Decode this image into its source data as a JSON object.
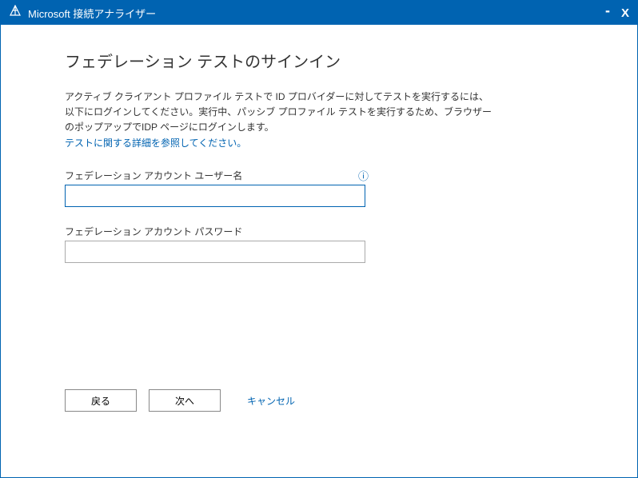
{
  "titlebar": {
    "app_title": "Microsoft 接続アナライザー",
    "minimize": "-",
    "close": "X"
  },
  "page": {
    "title": "フェデレーション テストのサインイン",
    "description_line1": "アクティブ クライアント プロファイル テストで ID プロバイダーに対してテストを実行するには、",
    "description_line2": "以下にログインしてください。実行中、パッシブ プロファイル テストを実行するため、ブラウザー",
    "description_line3": "のポップアップでIDP ページにログインします。",
    "link_text": "テストに関する詳細を参照してください。"
  },
  "fields": {
    "username_label": "フェデレーション アカウント ユーザー名",
    "username_value": "",
    "password_label": "フェデレーション アカウント パスワード",
    "password_value": ""
  },
  "buttons": {
    "back": "戻る",
    "next": "次へ",
    "cancel": "キャンセル"
  }
}
